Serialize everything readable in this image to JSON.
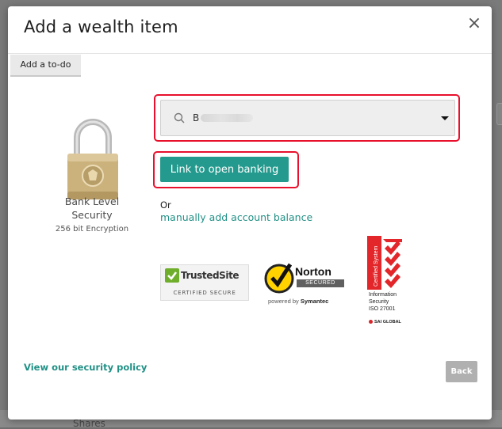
{
  "background": {
    "shares_label": "Shares"
  },
  "modal": {
    "title": "Add a wealth item",
    "close_symbol": "×",
    "todo_tab_label": "Add a to-do",
    "security": {
      "bank_level": "Bank Level Security",
      "encryption": "256 bit Encryption",
      "icon": "padlock-icon"
    },
    "institution_select": {
      "value": "B",
      "icon": "search-icon",
      "caret_icon": "caret-down-icon"
    },
    "link_button_label": "Link to open banking",
    "or_label": "Or",
    "manual_link_label": "manually add account balance",
    "badges": {
      "trusted_site": {
        "name": "TrustedSite",
        "subtitle": "CERTIFIED SECURE"
      },
      "norton": {
        "name": "Norton",
        "secured": "SECURED",
        "powered_by": "powered by",
        "brand": "Symantec"
      },
      "iso": {
        "vertical_text": "Certified System",
        "lines": [
          "Information",
          "Security",
          "ISO 27001"
        ],
        "issuer": "SAI GLOBAL"
      }
    },
    "security_policy_link": "View our security policy",
    "back_button_label": "Back"
  },
  "colors": {
    "accent": "#249a8e",
    "link": "#209085",
    "highlight": "#e8102c",
    "disabled": "#b0b0b0"
  }
}
